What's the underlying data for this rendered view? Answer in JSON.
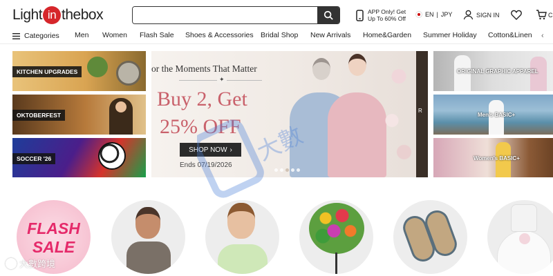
{
  "header": {
    "logo_prefix": "Light",
    "logo_in": "in",
    "logo_suffix": "thebox",
    "search_placeholder": "",
    "app_promo_line1": "APP Only! Get",
    "app_promo_line2": "Up To 60% Off",
    "language": "EN",
    "currency": "JPY",
    "sign_in": "SIGN IN",
    "cart_partial": "C"
  },
  "nav": {
    "categories": "Categories",
    "items": [
      "Men",
      "Women",
      "Flash Sale",
      "Shoes & Accessories",
      "Bridal Shop",
      "New Arrivals",
      "Home&Garden",
      "Summer Holiday",
      "Cotton&Linen"
    ]
  },
  "banners": {
    "left": [
      "KITCHEN UPGRADES",
      "OKTOBERFEST",
      "SOCCER '26"
    ],
    "hero": {
      "tagline": "or the Moments That Matter",
      "headline_line1": "Buy 2, Get",
      "headline_line2": "25% OFF",
      "cta": "SHOP NOW",
      "ends": "Ends 07/19/2026",
      "edge_letter": "R",
      "dot_count": 5,
      "active_dot": 2
    },
    "right": [
      "ORIGINAL GRAPHIC APPAREL",
      "Men's BASIC+",
      "Women's BASIC+"
    ]
  },
  "circles": {
    "flash_line1": "FLASH",
    "flash_line2": "SALE"
  },
  "watermark": {
    "corner_text": "大數跨境",
    "center_text": "大數跨境"
  },
  "colors": {
    "brand_red": "#d6262b",
    "hero_pink": "#c9616b",
    "flash_pink": "#e52a6a"
  }
}
